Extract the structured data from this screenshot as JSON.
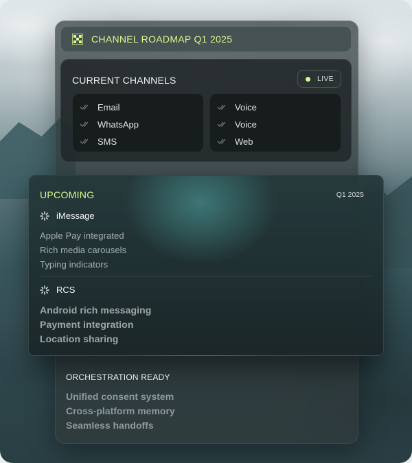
{
  "header": {
    "title": "CHANNEL ROADMAP Q1 2025",
    "icon": "checkerboard-icon"
  },
  "current": {
    "label": "CURRENT CHANNELS",
    "status": "LIVE",
    "columns": [
      [
        "Email",
        "WhatsApp",
        "SMS"
      ],
      [
        "Voice",
        "Voice",
        "Web"
      ]
    ]
  },
  "upcoming": {
    "title": "UPCOMING",
    "quarter": "Q1 2025",
    "sections": [
      {
        "name": "iMessage",
        "features": [
          "Apple Pay integrated",
          "Rich media carousels",
          "Typing indicators"
        ]
      },
      {
        "name": "RCS",
        "features": [
          "Android rich messaging",
          "Payment integration",
          "Location sharing"
        ]
      }
    ]
  },
  "orchestration": {
    "title": "ORCHESTRATION READY",
    "features": [
      "Unified consent system",
      "Cross-platform memory",
      "Seamless handoffs"
    ]
  },
  "colors": {
    "accent": "#d9f98a",
    "panel": "#303a3c",
    "card": "#22282a"
  }
}
